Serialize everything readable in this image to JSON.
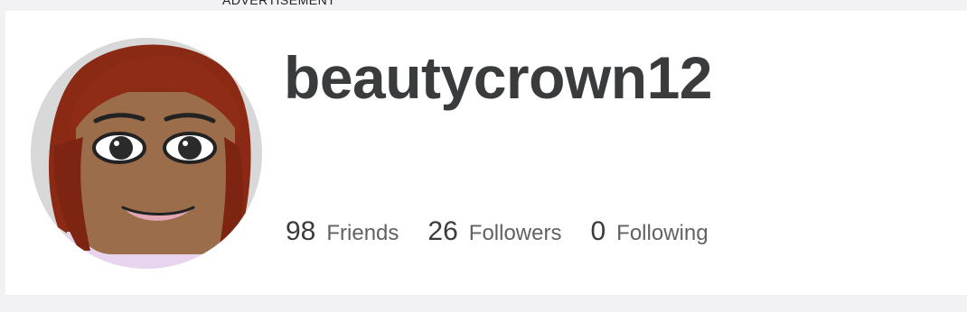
{
  "advertisement_label": "ADVERTISEMENT",
  "profile": {
    "username": "beautycrown12",
    "avatar_icon": "avatar-headshot-icon"
  },
  "stats": [
    {
      "count": "98",
      "label": "Friends"
    },
    {
      "count": "26",
      "label": "Followers"
    },
    {
      "count": "0",
      "label": "Following"
    }
  ],
  "colors": {
    "page_background": "#f2f2f4",
    "card_background": "#ffffff",
    "text_primary": "#393b3d",
    "text_secondary": "#606264"
  }
}
